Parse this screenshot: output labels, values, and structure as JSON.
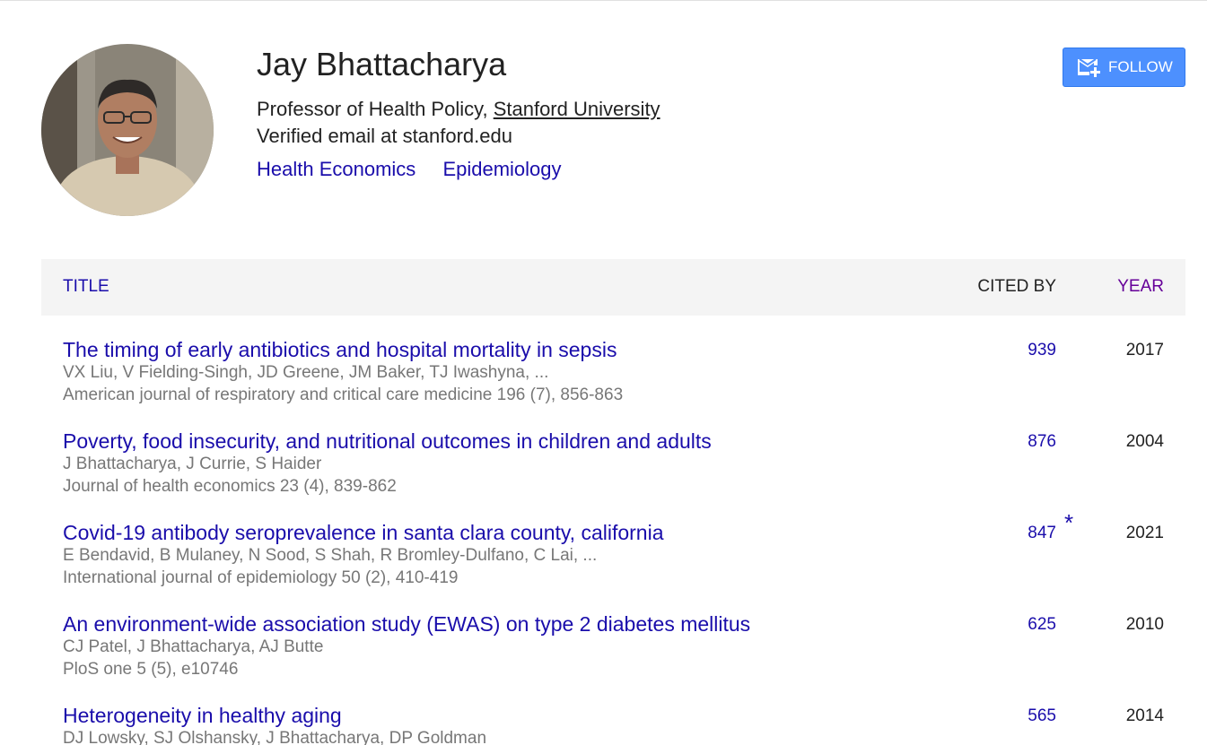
{
  "profile": {
    "name": "Jay Bhattacharya",
    "affiliation_prefix": "Professor of Health Policy, ",
    "university": "Stanford University",
    "email": "Verified email at stanford.edu",
    "interests": [
      "Health Economics",
      "Epidemiology"
    ]
  },
  "follow_label": "FOLLOW",
  "table": {
    "headers": {
      "title": "TITLE",
      "cited_by": "CITED BY",
      "year": "YEAR"
    },
    "rows": [
      {
        "title": "The timing of early antibiotics and hospital mortality in sepsis",
        "authors": "VX Liu, V Fielding-Singh, JD Greene, JM Baker, TJ Iwashyna, ...",
        "venue": "American journal of respiratory and critical care medicine 196 (7), 856-863",
        "cited": "939",
        "star": "",
        "year": "2017"
      },
      {
        "title": "Poverty, food insecurity, and nutritional outcomes in children and adults",
        "authors": "J Bhattacharya, J Currie, S Haider",
        "venue": "Journal of health economics 23 (4), 839-862",
        "cited": "876",
        "star": "",
        "year": "2004"
      },
      {
        "title": "Covid-19 antibody seroprevalence in santa clara county, california",
        "authors": "E Bendavid, B Mulaney, N Sood, S Shah, R Bromley-Dulfano, C Lai, ...",
        "venue": "International journal of epidemiology 50 (2), 410-419",
        "cited": "847",
        "star": "*",
        "year": "2021"
      },
      {
        "title": "An environment-wide association study (EWAS) on type 2 diabetes mellitus",
        "authors": "CJ Patel, J Bhattacharya, AJ Butte",
        "venue": "PloS one 5 (5), e10746",
        "cited": "625",
        "star": "",
        "year": "2010"
      },
      {
        "title": "Heterogeneity in healthy aging",
        "authors": "DJ Lowsky, SJ Olshansky, J Bhattacharya, DP Goldman",
        "venue": "",
        "cited": "565",
        "star": "",
        "year": "2014"
      }
    ]
  }
}
